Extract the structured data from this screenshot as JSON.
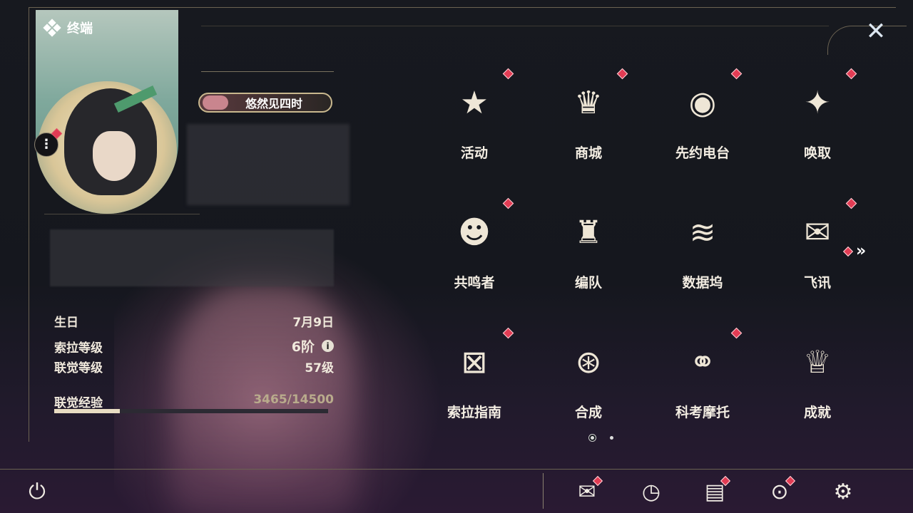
{
  "profile": {
    "section_label": "终端",
    "title_badge": "悠然见四时",
    "info": [
      {
        "label": "生日",
        "value": "7月9日"
      },
      {
        "label": "索拉等级",
        "value": "6阶"
      },
      {
        "label": "联觉等级",
        "value": "57级"
      }
    ],
    "exp": {
      "label": "联觉经验",
      "value": "3465/14500",
      "current": 3465,
      "max": 14500
    }
  },
  "menu": {
    "items": [
      {
        "label": "活动",
        "icon": "event-2hd-icon",
        "badge": true
      },
      {
        "label": "商城",
        "icon": "shop-cart-icon",
        "badge": true
      },
      {
        "label": "先约电台",
        "icon": "radio-vinyl-icon",
        "badge": true
      },
      {
        "label": "唤取",
        "icon": "convene-compass-icon",
        "badge": true
      },
      {
        "label": "共鸣者",
        "icon": "resonator-head-icon",
        "badge": true
      },
      {
        "label": "编队",
        "icon": "chess-pieces-icon",
        "badge": false
      },
      {
        "label": "数据坞",
        "icon": "data-bank-icon",
        "badge": false
      },
      {
        "label": "飞讯",
        "icon": "chat-bubble-icon",
        "badge": true
      },
      {
        "label": "索拉指南",
        "icon": "guide-book-icon",
        "badge": true
      },
      {
        "label": "合成",
        "icon": "synthesis-orb-icon",
        "badge": false
      },
      {
        "label": "科考摩托",
        "icon": "motorbike-icon",
        "badge": true
      },
      {
        "label": "成就",
        "icon": "trophy-icon",
        "badge": false
      }
    ],
    "next_page_icon": "double-chevron-right-icon",
    "pages": 2,
    "current_page": 1
  },
  "bottom_bar": {
    "icons": [
      "mail-icon",
      "clock-icon",
      "notes-icon",
      "camera-icon",
      "settings-gear-icon"
    ],
    "power_icon": "power-icon"
  },
  "colors": {
    "badge": "#e23c54",
    "accent": "#c9b88e",
    "text": "#f3ede2"
  }
}
